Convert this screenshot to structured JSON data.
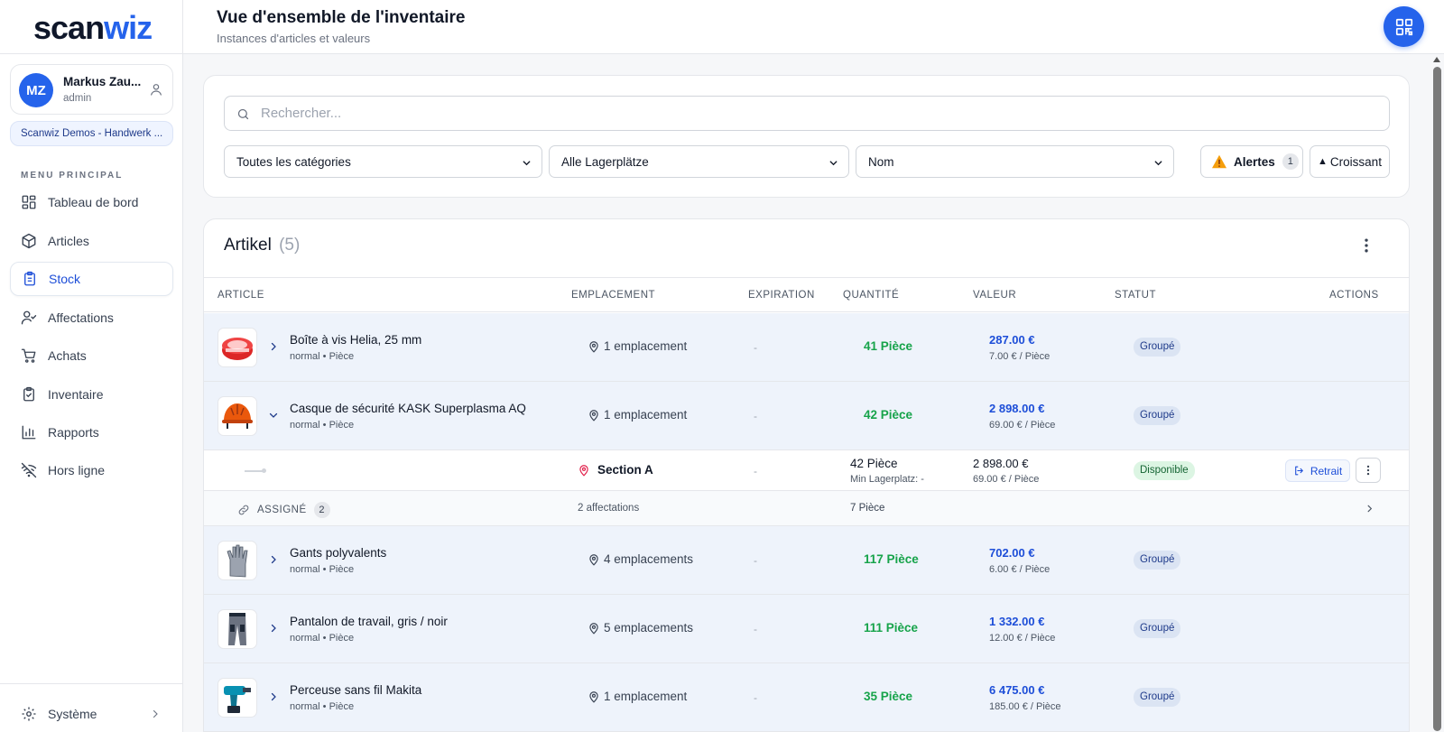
{
  "app": {
    "logo_part1": "scan",
    "logo_part2": "wiz"
  },
  "user": {
    "initials": "MZ",
    "name": "Markus Zau...",
    "role": "admin"
  },
  "company": "Scanwiz Demos - Handwerk ...",
  "menu": {
    "title": "MENU PRINCIPAL",
    "items": [
      {
        "label": "Tableau de bord",
        "icon": "dashboard-icon"
      },
      {
        "label": "Articles",
        "icon": "box-icon"
      },
      {
        "label": "Stock",
        "icon": "clipboard-icon",
        "active": true
      },
      {
        "label": "Affectations",
        "icon": "user-check-icon"
      },
      {
        "label": "Achats",
        "icon": "cart-icon"
      },
      {
        "label": "Inventaire",
        "icon": "clipboard-check-icon"
      },
      {
        "label": "Rapports",
        "icon": "bar-chart-icon"
      },
      {
        "label": "Hors ligne",
        "icon": "wifi-off-icon"
      }
    ],
    "system": "Système"
  },
  "header": {
    "title": "Vue d'ensemble de l'inventaire",
    "subtitle": "Instances d'articles et valeurs"
  },
  "filters": {
    "search_placeholder": "Rechercher...",
    "category": "Toutes les catégories",
    "location": "Alle Lagerplätze",
    "sort_field": "Nom",
    "alerts_label": "Alertes",
    "alerts_count": "1",
    "sort_order": "Croissant"
  },
  "table": {
    "title": "Artikel",
    "count": "(5)",
    "columns": [
      "ARTICLE",
      "EMPLACEMENT",
      "EXPIRATION",
      "QUANTITÉ",
      "VALEUR",
      "STATUT",
      "ACTIONS"
    ],
    "rows": [
      {
        "name": "Boîte à vis Helia, 25 mm",
        "meta": "normal • Pièce",
        "location": "1 emplacement",
        "expiration": "-",
        "quantity": "41 Pièce",
        "value": "287.00 €",
        "unit_value": "7.00 € / Pièce",
        "status": "Groupé"
      },
      {
        "name": "Casque de sécurité KASK Superplasma AQ",
        "meta": "normal • Pièce",
        "location": "1 emplacement",
        "expiration": "-",
        "quantity": "42 Pièce",
        "value": "2 898.00 €",
        "unit_value": "69.00 € / Pièce",
        "status": "Groupé"
      },
      {
        "name": "Gants polyvalents",
        "meta": "normal • Pièce",
        "location": "4 emplacements",
        "expiration": "-",
        "quantity": "117 Pièce",
        "value": "702.00 €",
        "unit_value": "6.00 € / Pièce",
        "status": "Groupé"
      },
      {
        "name": "Pantalon de travail, gris / noir",
        "meta": "normal • Pièce",
        "location": "5 emplacements",
        "expiration": "-",
        "quantity": "111 Pièce",
        "value": "1 332.00 €",
        "unit_value": "12.00 € / Pièce",
        "status": "Groupé"
      },
      {
        "name": "Perceuse sans fil Makita",
        "meta": "normal • Pièce",
        "location": "1 emplacement",
        "expiration": "-",
        "quantity": "35 Pièce",
        "value": "6 475.00 €",
        "unit_value": "185.00 € / Pièce",
        "status": "Groupé"
      }
    ],
    "expanded": {
      "location": "Section A",
      "expiration": "-",
      "quantity": "42 Pièce",
      "min_stock": "Min Lagerplatz: -",
      "value": "2 898.00 €",
      "unit_value": "69.00 € / Pièce",
      "status": "Disponible",
      "action": "Retrait"
    },
    "assigned": {
      "label": "ASSIGNÉ",
      "count": "2",
      "assignments": "2 affectations",
      "quantity": "7 Pièce"
    }
  }
}
